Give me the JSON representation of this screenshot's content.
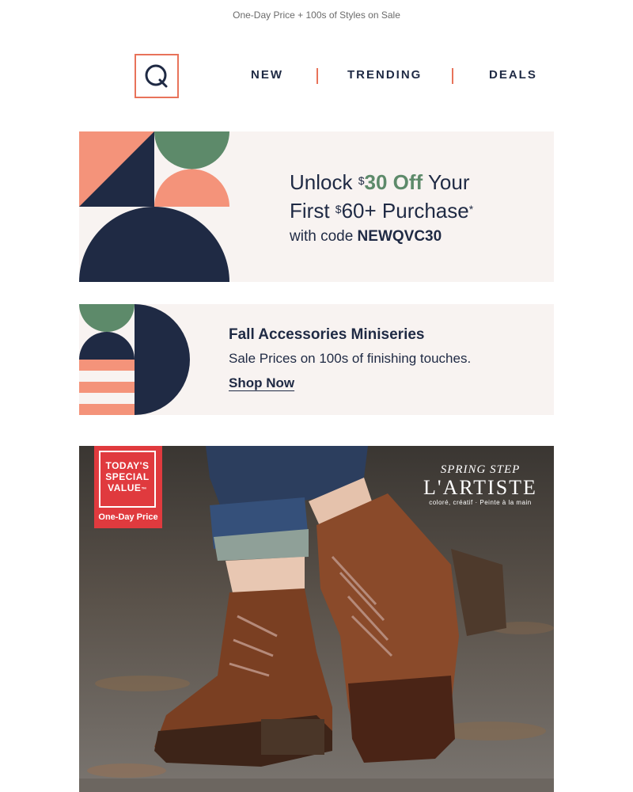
{
  "preheader": "One-Day Price + 100s of Styles on Sale",
  "header": {
    "logo_letter": "Q",
    "nav": [
      {
        "label": "NEW"
      },
      {
        "label": "TRENDING"
      },
      {
        "label": "DEALS"
      }
    ]
  },
  "promo_banner": {
    "line1_prefix": "Unlock ",
    "line1_currency": "$",
    "line1_amount": "30 Off",
    "line1_suffix": " Your",
    "line2_prefix": "First ",
    "line2_currency": "$",
    "line2_amount": "60+ Purchase",
    "line2_asterisk": "*",
    "line3_prefix": "with code ",
    "code": "NEWQVC30"
  },
  "miniseries_banner": {
    "title": "Fall Accessories Miniseries",
    "subtitle": "Sale Prices on 100s of finishing touches.",
    "cta": "Shop Now"
  },
  "hero": {
    "badge_line1": "TODAY'S",
    "badge_line2": "SPECIAL",
    "badge_line3": "VALUE",
    "badge_tm": "™",
    "badge_bottom": "One-Day Price",
    "brand_top": "SPRING STEP",
    "brand_main": "L'ARTISTE",
    "brand_tag": "coloré, créatif · Peinte à la main"
  },
  "colors": {
    "navy": "#1f2a44",
    "coral": "#e8735a",
    "salmon": "#f4937a",
    "sage": "#5d8a6a",
    "cream": "#f8f3f1",
    "badge_red": "#e03a3e"
  }
}
